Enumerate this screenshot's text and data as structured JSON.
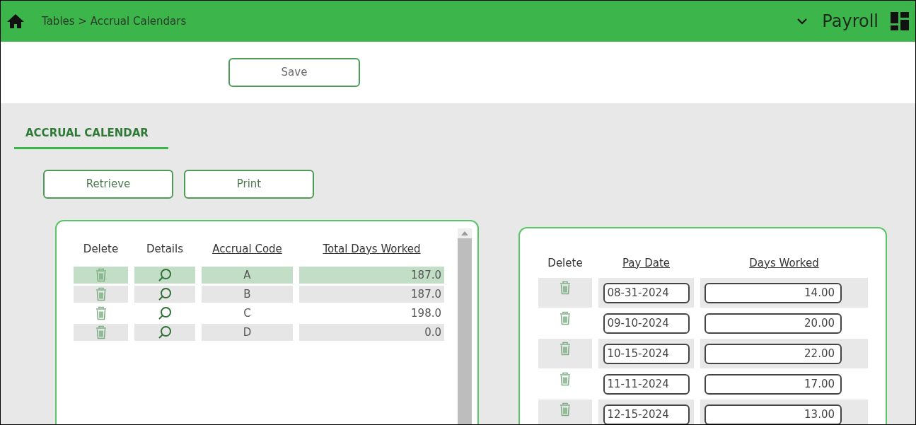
{
  "header": {
    "breadcrumb": "Tables > Accrual Calendars",
    "app_name": "Payroll"
  },
  "toolbar": {
    "save": "Save"
  },
  "section_tab": {
    "label": "ACCRUAL CALENDAR",
    "selected": true
  },
  "actions": [
    "Retrieve",
    "Print"
  ],
  "accrual_table": {
    "columns": [
      "Delete",
      "Details",
      "Accrual Code",
      "Total Days Worked"
    ],
    "rows": [
      {
        "code": "A",
        "total": "187.0",
        "selected": true
      },
      {
        "code": "B",
        "total": "187.0",
        "selected": false
      },
      {
        "code": "C",
        "total": "198.0",
        "selected": false
      },
      {
        "code": "D",
        "total": "0.0",
        "selected": false
      }
    ]
  },
  "pay_table": {
    "columns": [
      "Delete",
      "Pay Date",
      "Days Worked"
    ],
    "rows": [
      {
        "pay_date": "08-31-2024",
        "days": "14.00"
      },
      {
        "pay_date": "09-10-2024",
        "days": "20.00"
      },
      {
        "pay_date": "10-15-2024",
        "days": "22.00"
      },
      {
        "pay_date": "11-11-2024",
        "days": "17.00"
      },
      {
        "pay_date": "12-15-2024",
        "days": "13.00"
      }
    ]
  }
}
